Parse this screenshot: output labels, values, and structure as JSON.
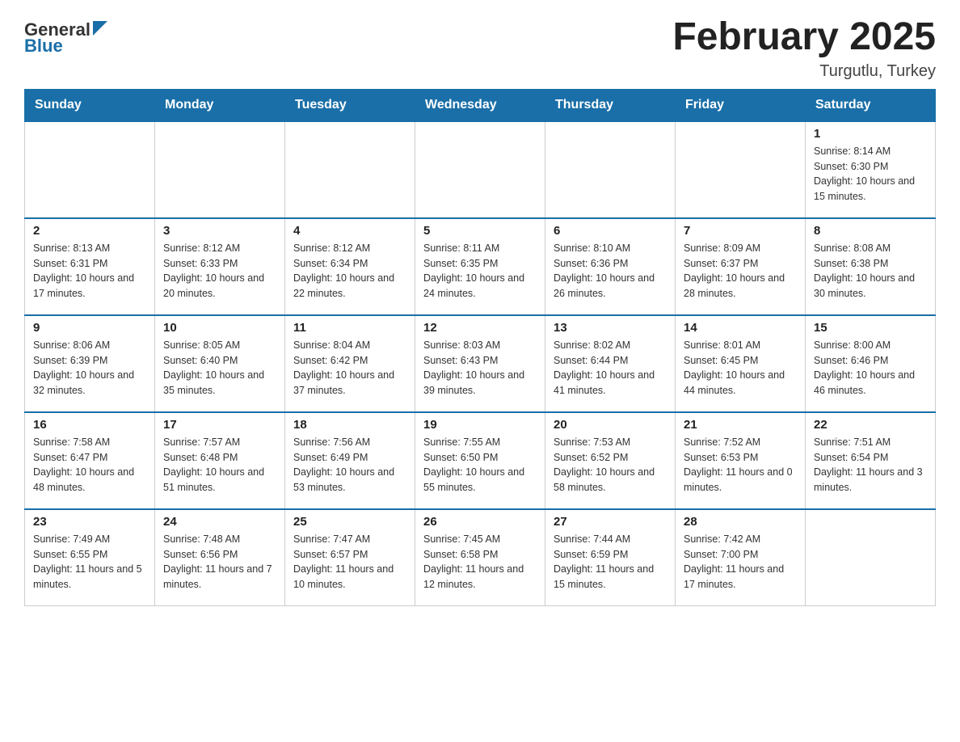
{
  "header": {
    "logo_general": "General",
    "logo_blue": "Blue",
    "month_title": "February 2025",
    "location": "Turgutlu, Turkey"
  },
  "weekdays": [
    "Sunday",
    "Monday",
    "Tuesday",
    "Wednesday",
    "Thursday",
    "Friday",
    "Saturday"
  ],
  "weeks": [
    [
      {
        "day": "",
        "empty": true
      },
      {
        "day": "",
        "empty": true
      },
      {
        "day": "",
        "empty": true
      },
      {
        "day": "",
        "empty": true
      },
      {
        "day": "",
        "empty": true
      },
      {
        "day": "",
        "empty": true
      },
      {
        "day": "1",
        "sunrise": "Sunrise: 8:14 AM",
        "sunset": "Sunset: 6:30 PM",
        "daylight": "Daylight: 10 hours and 15 minutes."
      }
    ],
    [
      {
        "day": "2",
        "sunrise": "Sunrise: 8:13 AM",
        "sunset": "Sunset: 6:31 PM",
        "daylight": "Daylight: 10 hours and 17 minutes."
      },
      {
        "day": "3",
        "sunrise": "Sunrise: 8:12 AM",
        "sunset": "Sunset: 6:33 PM",
        "daylight": "Daylight: 10 hours and 20 minutes."
      },
      {
        "day": "4",
        "sunrise": "Sunrise: 8:12 AM",
        "sunset": "Sunset: 6:34 PM",
        "daylight": "Daylight: 10 hours and 22 minutes."
      },
      {
        "day": "5",
        "sunrise": "Sunrise: 8:11 AM",
        "sunset": "Sunset: 6:35 PM",
        "daylight": "Daylight: 10 hours and 24 minutes."
      },
      {
        "day": "6",
        "sunrise": "Sunrise: 8:10 AM",
        "sunset": "Sunset: 6:36 PM",
        "daylight": "Daylight: 10 hours and 26 minutes."
      },
      {
        "day": "7",
        "sunrise": "Sunrise: 8:09 AM",
        "sunset": "Sunset: 6:37 PM",
        "daylight": "Daylight: 10 hours and 28 minutes."
      },
      {
        "day": "8",
        "sunrise": "Sunrise: 8:08 AM",
        "sunset": "Sunset: 6:38 PM",
        "daylight": "Daylight: 10 hours and 30 minutes."
      }
    ],
    [
      {
        "day": "9",
        "sunrise": "Sunrise: 8:06 AM",
        "sunset": "Sunset: 6:39 PM",
        "daylight": "Daylight: 10 hours and 32 minutes."
      },
      {
        "day": "10",
        "sunrise": "Sunrise: 8:05 AM",
        "sunset": "Sunset: 6:40 PM",
        "daylight": "Daylight: 10 hours and 35 minutes."
      },
      {
        "day": "11",
        "sunrise": "Sunrise: 8:04 AM",
        "sunset": "Sunset: 6:42 PM",
        "daylight": "Daylight: 10 hours and 37 minutes."
      },
      {
        "day": "12",
        "sunrise": "Sunrise: 8:03 AM",
        "sunset": "Sunset: 6:43 PM",
        "daylight": "Daylight: 10 hours and 39 minutes."
      },
      {
        "day": "13",
        "sunrise": "Sunrise: 8:02 AM",
        "sunset": "Sunset: 6:44 PM",
        "daylight": "Daylight: 10 hours and 41 minutes."
      },
      {
        "day": "14",
        "sunrise": "Sunrise: 8:01 AM",
        "sunset": "Sunset: 6:45 PM",
        "daylight": "Daylight: 10 hours and 44 minutes."
      },
      {
        "day": "15",
        "sunrise": "Sunrise: 8:00 AM",
        "sunset": "Sunset: 6:46 PM",
        "daylight": "Daylight: 10 hours and 46 minutes."
      }
    ],
    [
      {
        "day": "16",
        "sunrise": "Sunrise: 7:58 AM",
        "sunset": "Sunset: 6:47 PM",
        "daylight": "Daylight: 10 hours and 48 minutes."
      },
      {
        "day": "17",
        "sunrise": "Sunrise: 7:57 AM",
        "sunset": "Sunset: 6:48 PM",
        "daylight": "Daylight: 10 hours and 51 minutes."
      },
      {
        "day": "18",
        "sunrise": "Sunrise: 7:56 AM",
        "sunset": "Sunset: 6:49 PM",
        "daylight": "Daylight: 10 hours and 53 minutes."
      },
      {
        "day": "19",
        "sunrise": "Sunrise: 7:55 AM",
        "sunset": "Sunset: 6:50 PM",
        "daylight": "Daylight: 10 hours and 55 minutes."
      },
      {
        "day": "20",
        "sunrise": "Sunrise: 7:53 AM",
        "sunset": "Sunset: 6:52 PM",
        "daylight": "Daylight: 10 hours and 58 minutes."
      },
      {
        "day": "21",
        "sunrise": "Sunrise: 7:52 AM",
        "sunset": "Sunset: 6:53 PM",
        "daylight": "Daylight: 11 hours and 0 minutes."
      },
      {
        "day": "22",
        "sunrise": "Sunrise: 7:51 AM",
        "sunset": "Sunset: 6:54 PM",
        "daylight": "Daylight: 11 hours and 3 minutes."
      }
    ],
    [
      {
        "day": "23",
        "sunrise": "Sunrise: 7:49 AM",
        "sunset": "Sunset: 6:55 PM",
        "daylight": "Daylight: 11 hours and 5 minutes."
      },
      {
        "day": "24",
        "sunrise": "Sunrise: 7:48 AM",
        "sunset": "Sunset: 6:56 PM",
        "daylight": "Daylight: 11 hours and 7 minutes."
      },
      {
        "day": "25",
        "sunrise": "Sunrise: 7:47 AM",
        "sunset": "Sunset: 6:57 PM",
        "daylight": "Daylight: 11 hours and 10 minutes."
      },
      {
        "day": "26",
        "sunrise": "Sunrise: 7:45 AM",
        "sunset": "Sunset: 6:58 PM",
        "daylight": "Daylight: 11 hours and 12 minutes."
      },
      {
        "day": "27",
        "sunrise": "Sunrise: 7:44 AM",
        "sunset": "Sunset: 6:59 PM",
        "daylight": "Daylight: 11 hours and 15 minutes."
      },
      {
        "day": "28",
        "sunrise": "Sunrise: 7:42 AM",
        "sunset": "Sunset: 7:00 PM",
        "daylight": "Daylight: 11 hours and 17 minutes."
      },
      {
        "day": "",
        "empty": true
      }
    ]
  ]
}
